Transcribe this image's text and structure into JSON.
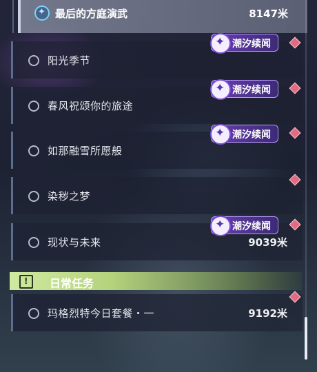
{
  "quests": [
    {
      "name": "最后的方庭演武",
      "distance": "8147米",
      "active": true
    },
    {
      "name": "阳光季节",
      "distance": "",
      "badge": true
    },
    {
      "name": "春风祝颂你的旅途",
      "distance": "",
      "badge": true
    },
    {
      "name": "如那融雪所愿般",
      "distance": "",
      "badge": true
    },
    {
      "name": "染秽之梦",
      "distance": "",
      "badge": false
    },
    {
      "name": "现状与未来",
      "distance": "9039米",
      "badge": true
    },
    {
      "name": "玛格烈特今日套餐・一",
      "distance": "9192米",
      "badge": false
    }
  ],
  "badge_label": "潮汐续闻",
  "daily_section": {
    "label": "日常任务"
  },
  "icons": {
    "active": "compass-star-icon",
    "badge": "tidal-star-icon",
    "diamond": "marker-diamond-icon",
    "daily": "exclamation-box-icon"
  },
  "colors": {
    "badge": "#6a3fb0",
    "daily_header": "#c6e394",
    "marker": "#e06b82"
  }
}
